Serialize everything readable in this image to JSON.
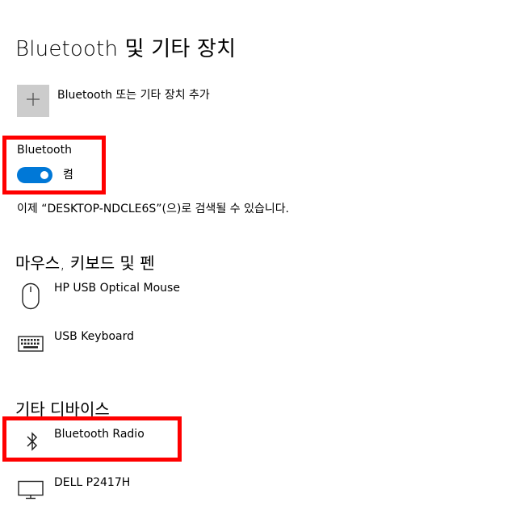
{
  "page": {
    "title": "Bluetooth 및 기타 장치"
  },
  "add_device": {
    "label": "Bluetooth 또는 기타 장치 추가",
    "icon": "plus-icon"
  },
  "bluetooth": {
    "label": "Bluetooth",
    "toggle_on": true,
    "toggle_state_label": "켬",
    "discoverable_text": "이제 “DESKTOP-NDCLE6S”(으)로 검색될 수 있습니다.",
    "accent_color": "#0078d7"
  },
  "mouse_keyboard_pen": {
    "title": "마우스, 키보드 및 펜",
    "devices": [
      {
        "name": "HP USB Optical Mouse",
        "icon": "mouse-icon"
      },
      {
        "name": "USB Keyboard",
        "icon": "keyboard-icon"
      }
    ]
  },
  "other_devices": {
    "title": "기타 디바이스",
    "devices": [
      {
        "name": "Bluetooth Radio",
        "icon": "bluetooth-icon"
      },
      {
        "name": "DELL P2417H",
        "icon": "monitor-icon"
      }
    ]
  },
  "highlight_color": "#ff0000"
}
